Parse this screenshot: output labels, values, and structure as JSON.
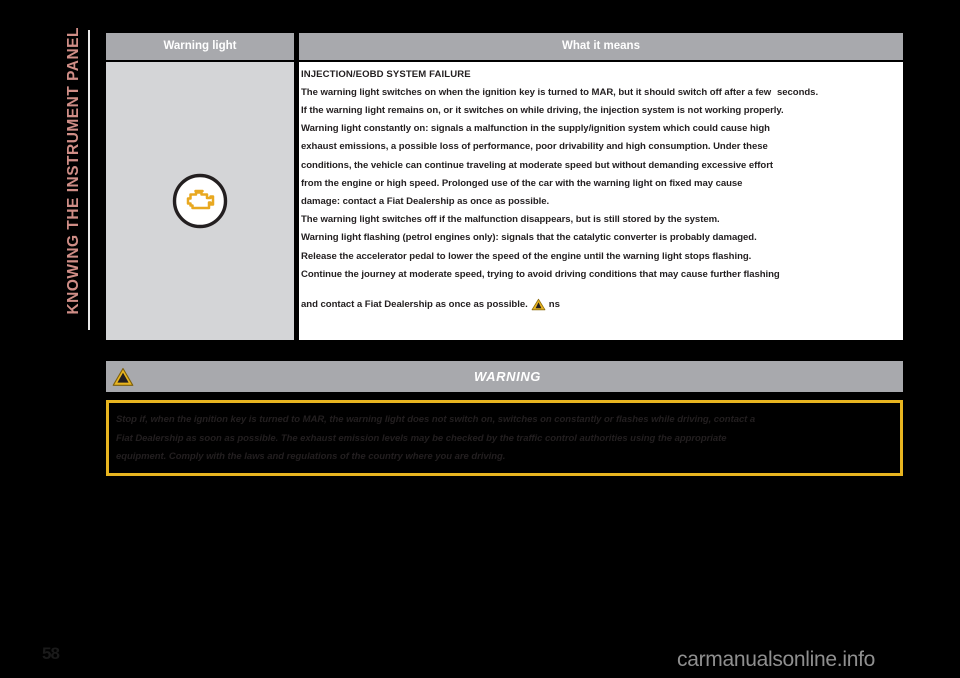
{
  "chapter": {
    "title": "KNOWING THE INSTRUMENT PANEL"
  },
  "page": {
    "number": "58",
    "watermark": "carmanualsonline.info"
  },
  "table": {
    "headers": {
      "warning_light": "Warning light",
      "what_it_means": "What it means"
    },
    "warning_light_icon": "engine-check-icon",
    "what_it_means": {
      "heading": "INJECTION/EOBD SYSTEM FAILURE",
      "lines": [
        "The warning light switches on when the ignition key is turned to MAR, but it should switch off after a few",
        "seconds.",
        "If the warning light remains on, or it switches on while driving, the injection system is not working properly.",
        "Warning light constantly on: signals a malfunction in the supply/ignition system which could cause high",
        "exhaust emissions, a possible loss of performance, poor drivability and high consumption. Under these",
        "conditions, the vehicle can continue traveling at moderate speed but without demanding excessive effort",
        "from the engine or high speed. Prolonged use of the car with the warning light on fixed may cause",
        "damage: contact a Fiat Dealership as once as possible.",
        "The warning light switches off if the malfunction disappears, but is still stored by the system.",
        "Warning light flashing (petrol engines only): signals that the catalytic converter is probably damaged.",
        "Release the accelerator pedal to lower the speed of the engine until the warning light stops flashing.",
        "Continue the journey at moderate speed, trying to avoid driving conditions that may cause further flashing"
      ],
      "last_line_prefix": "and contact a Fiat Dealership as once as possible.",
      "last_line_icon": "warning-triangle-icon",
      "last_line_suffix": "ns"
    }
  },
  "warning_banner": {
    "icon": "warning-triangle-icon",
    "label": "WARNING"
  },
  "warning_note": {
    "lines": [
      "Stop if, when the ignition key is turned to MAR, the warning light does not switch on, switches on constantly or flashes while driving, contact a",
      "Fiat Dealership as soon as possible. The exhaust emission levels may be checked by the traffic control authorities using the appropriate",
      "equipment. Comply with the laws and regulations of the country where you are driving."
    ]
  },
  "colors": {
    "page_background": "#000000",
    "header_gray": "#a8a9ad",
    "cell_gray": "#d4d5d7",
    "accent_yellow": "#e8b520",
    "chapter_pink": "#cf8d86",
    "text_dark": "#231f20"
  }
}
